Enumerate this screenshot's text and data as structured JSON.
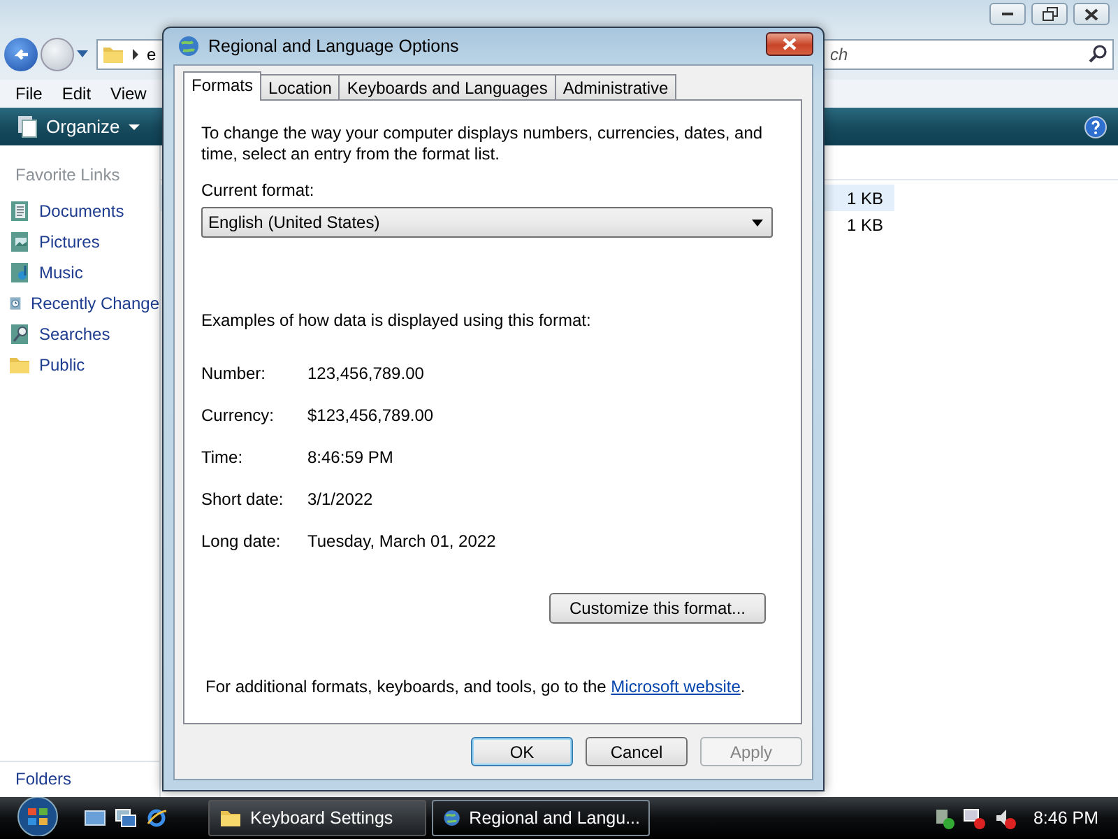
{
  "explorer": {
    "address": "e",
    "search_placeholder": "ch",
    "menu": [
      "File",
      "Edit",
      "View"
    ],
    "organize": "Organize",
    "favorites_title": "Favorite Links",
    "links": [
      {
        "label": "Documents"
      },
      {
        "label": "Pictures"
      },
      {
        "label": "Music"
      },
      {
        "label": "Recently Change"
      },
      {
        "label": "Searches"
      },
      {
        "label": "Public"
      }
    ],
    "files": [
      {
        "size": "1 KB",
        "selected": true
      },
      {
        "size": "1 KB",
        "selected": false
      }
    ],
    "folders": "Folders"
  },
  "dialog": {
    "title": "Regional and Language Options",
    "tabs": [
      {
        "label": "Formats",
        "selected": true
      },
      {
        "label": "Location",
        "selected": false
      },
      {
        "label": "Keyboards and Languages",
        "selected": false
      },
      {
        "label": "Administrative",
        "selected": false
      }
    ],
    "intro": "To change the way your computer displays numbers, currencies, dates, and time, select an entry from the format list.",
    "current_format_label": "Current format:",
    "current_format": "English (United States)",
    "examples_heading": "Examples of how data is displayed using this format:",
    "examples": [
      {
        "label": "Number:",
        "value": "123,456,789.00"
      },
      {
        "label": "Currency:",
        "value": "$123,456,789.00"
      },
      {
        "label": "Time:",
        "value": "8:46:59 PM"
      },
      {
        "label": "Short date:",
        "value": "3/1/2022"
      },
      {
        "label": "Long date:",
        "value": "Tuesday, March 01, 2022"
      }
    ],
    "customize_button": "Customize this format...",
    "footer": {
      "text": "For additional formats, keyboards, and tools, go to the ",
      "link": "Microsoft website",
      "end": "."
    },
    "buttons": [
      {
        "label": "OK",
        "default": true,
        "disabled": false
      },
      {
        "label": "Cancel",
        "default": false,
        "disabled": false
      },
      {
        "label": "Apply",
        "default": false,
        "disabled": true
      }
    ]
  },
  "taskbar": {
    "tasks": [
      {
        "label": "Keyboard Settings",
        "selected": false
      },
      {
        "label": "Regional and Langu...",
        "selected": true
      }
    ],
    "clock": "8:46 PM"
  }
}
